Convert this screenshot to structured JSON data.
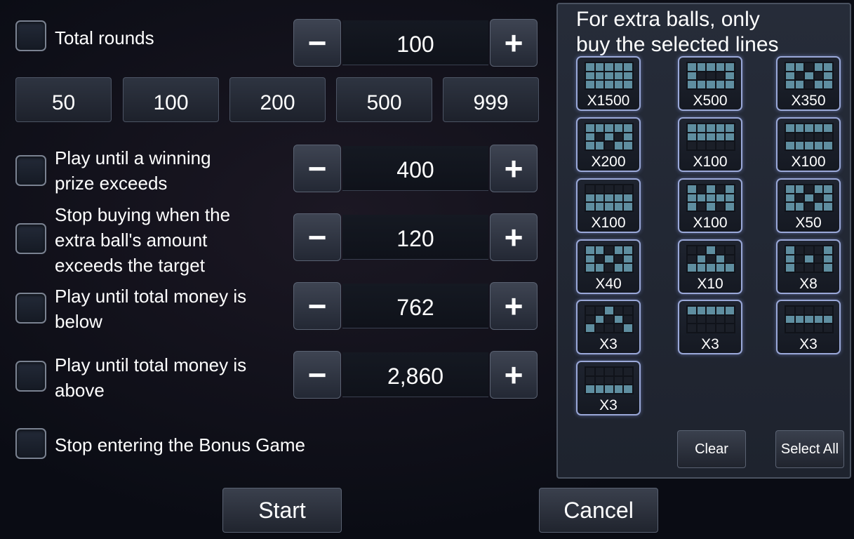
{
  "rounds": {
    "label": "Total rounds",
    "value": "100"
  },
  "presets": [
    "50",
    "100",
    "200",
    "500",
    "999"
  ],
  "conditions": [
    {
      "id": "win",
      "lines": [
        "Play until a winning",
        "prize exceeds"
      ],
      "value": "400"
    },
    {
      "id": "extra",
      "lines": [
        "Stop buying when the",
        "extra ball's amount",
        "exceeds the target"
      ],
      "value": "120"
    },
    {
      "id": "below",
      "lines": [
        "Play until total money is",
        "below"
      ],
      "value": "762"
    },
    {
      "id": "above",
      "lines": [
        "Play until total money is",
        "above"
      ],
      "value": "2,860"
    }
  ],
  "bonus": {
    "label": "Stop entering the Bonus Game"
  },
  "stepper": {
    "minus": "−",
    "plus": "+"
  },
  "buttons": {
    "start": "Start",
    "cancel": "Cancel"
  },
  "extra_balls": {
    "title_line1": "For extra balls, only",
    "title_line2": "buy the selected lines",
    "clear": "Clear",
    "select_all": "Select All",
    "lines": [
      {
        "mult": "X1500",
        "pattern": [
          "11111",
          "11111",
          "11111"
        ]
      },
      {
        "mult": "X500",
        "pattern": [
          "11111",
          "10001",
          "11111"
        ]
      },
      {
        "mult": "X350",
        "pattern": [
          "11011",
          "10101",
          "11011"
        ]
      },
      {
        "mult": "X200",
        "pattern": [
          "11111",
          "10101",
          "11011"
        ]
      },
      {
        "mult": "X100",
        "pattern": [
          "11111",
          "11111",
          "00000"
        ]
      },
      {
        "mult": "X100",
        "pattern": [
          "11111",
          "00000",
          "11111"
        ]
      },
      {
        "mult": "X100",
        "pattern": [
          "00000",
          "11111",
          "11111"
        ]
      },
      {
        "mult": "X100",
        "pattern": [
          "10101",
          "11111",
          "10101"
        ]
      },
      {
        "mult": "X50",
        "pattern": [
          "11011",
          "10101",
          "11011"
        ]
      },
      {
        "mult": "X40",
        "pattern": [
          "11011",
          "10101",
          "11011"
        ]
      },
      {
        "mult": "X10",
        "pattern": [
          "00100",
          "01010",
          "11111"
        ]
      },
      {
        "mult": "X8",
        "pattern": [
          "10001",
          "10101",
          "10001"
        ]
      },
      {
        "mult": "X3",
        "pattern": [
          "00100",
          "01010",
          "10001"
        ]
      },
      {
        "mult": "X3",
        "pattern": [
          "11111",
          "00000",
          "00000"
        ]
      },
      {
        "mult": "X3",
        "pattern": [
          "00000",
          "11111",
          "00000"
        ]
      },
      {
        "mult": "X3",
        "pattern": [
          "00000",
          "00000",
          "11111"
        ]
      }
    ]
  }
}
